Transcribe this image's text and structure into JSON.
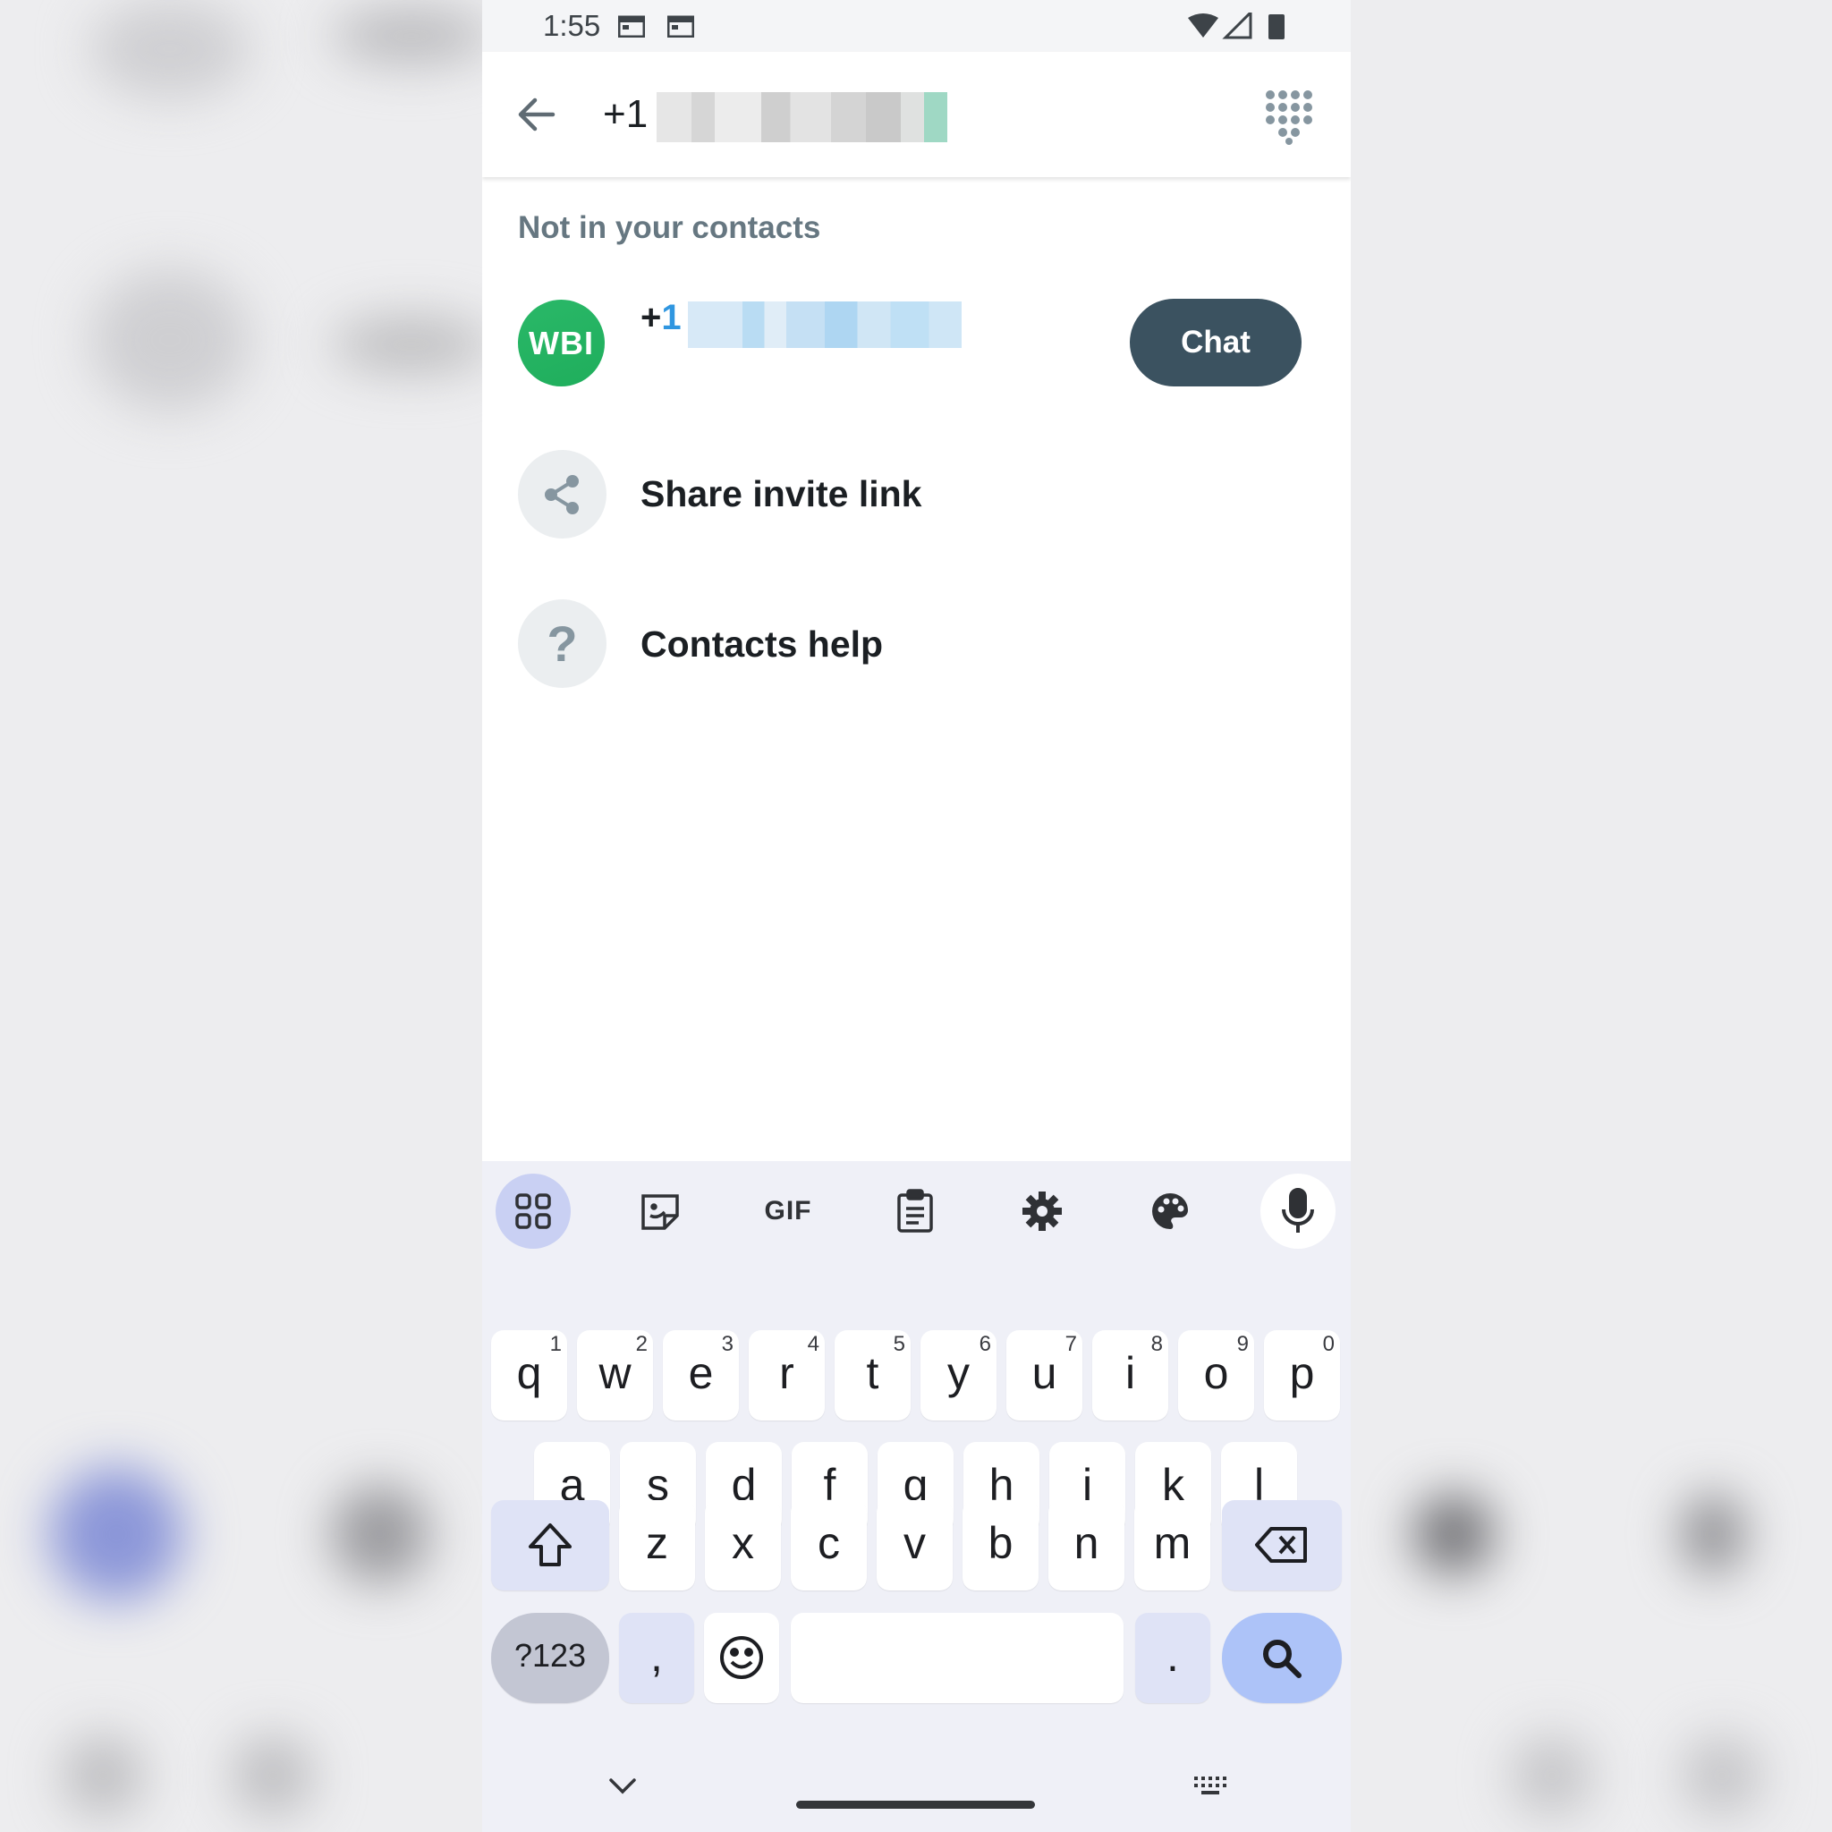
{
  "status_bar": {
    "time": "1:55",
    "icons": [
      "calendar-icon",
      "calendar-icon",
      "wifi-icon",
      "signal-icon",
      "battery-icon"
    ]
  },
  "app_bar": {
    "back_icon": "arrow-left-icon",
    "search_value": "+1",
    "dialpad_icon": "dialpad-icon"
  },
  "section": {
    "label": "Not in your contacts"
  },
  "contact": {
    "avatar_text": "WBI",
    "number_prefix": "+",
    "number_country": "1",
    "chat_label": "Chat"
  },
  "actions": [
    {
      "label": "Share invite link",
      "icon": "share-icon"
    },
    {
      "label": "Contacts help",
      "icon": "help-icon"
    }
  ],
  "keyboard": {
    "tools": [
      "apps-grid-icon",
      "sticker-icon",
      "GIF",
      "clipboard-icon",
      "settings-icon",
      "palette-icon",
      "microphone-icon"
    ],
    "row1": [
      {
        "k": "q",
        "h": "1"
      },
      {
        "k": "w",
        "h": "2"
      },
      {
        "k": "e",
        "h": "3"
      },
      {
        "k": "r",
        "h": "4"
      },
      {
        "k": "t",
        "h": "5"
      },
      {
        "k": "y",
        "h": "6"
      },
      {
        "k": "u",
        "h": "7"
      },
      {
        "k": "i",
        "h": "8"
      },
      {
        "k": "o",
        "h": "9"
      },
      {
        "k": "p",
        "h": "0"
      }
    ],
    "row2": [
      "a",
      "s",
      "d",
      "f",
      "g",
      "h",
      "j",
      "k",
      "l"
    ],
    "row3": [
      "z",
      "x",
      "c",
      "v",
      "b",
      "n",
      "m"
    ],
    "sym_label": "?123",
    "comma": ",",
    "period": "."
  },
  "colors": {
    "chat_button": "#3b5260",
    "avatar": "#25b364",
    "accent_blue": "#2f96e0"
  }
}
